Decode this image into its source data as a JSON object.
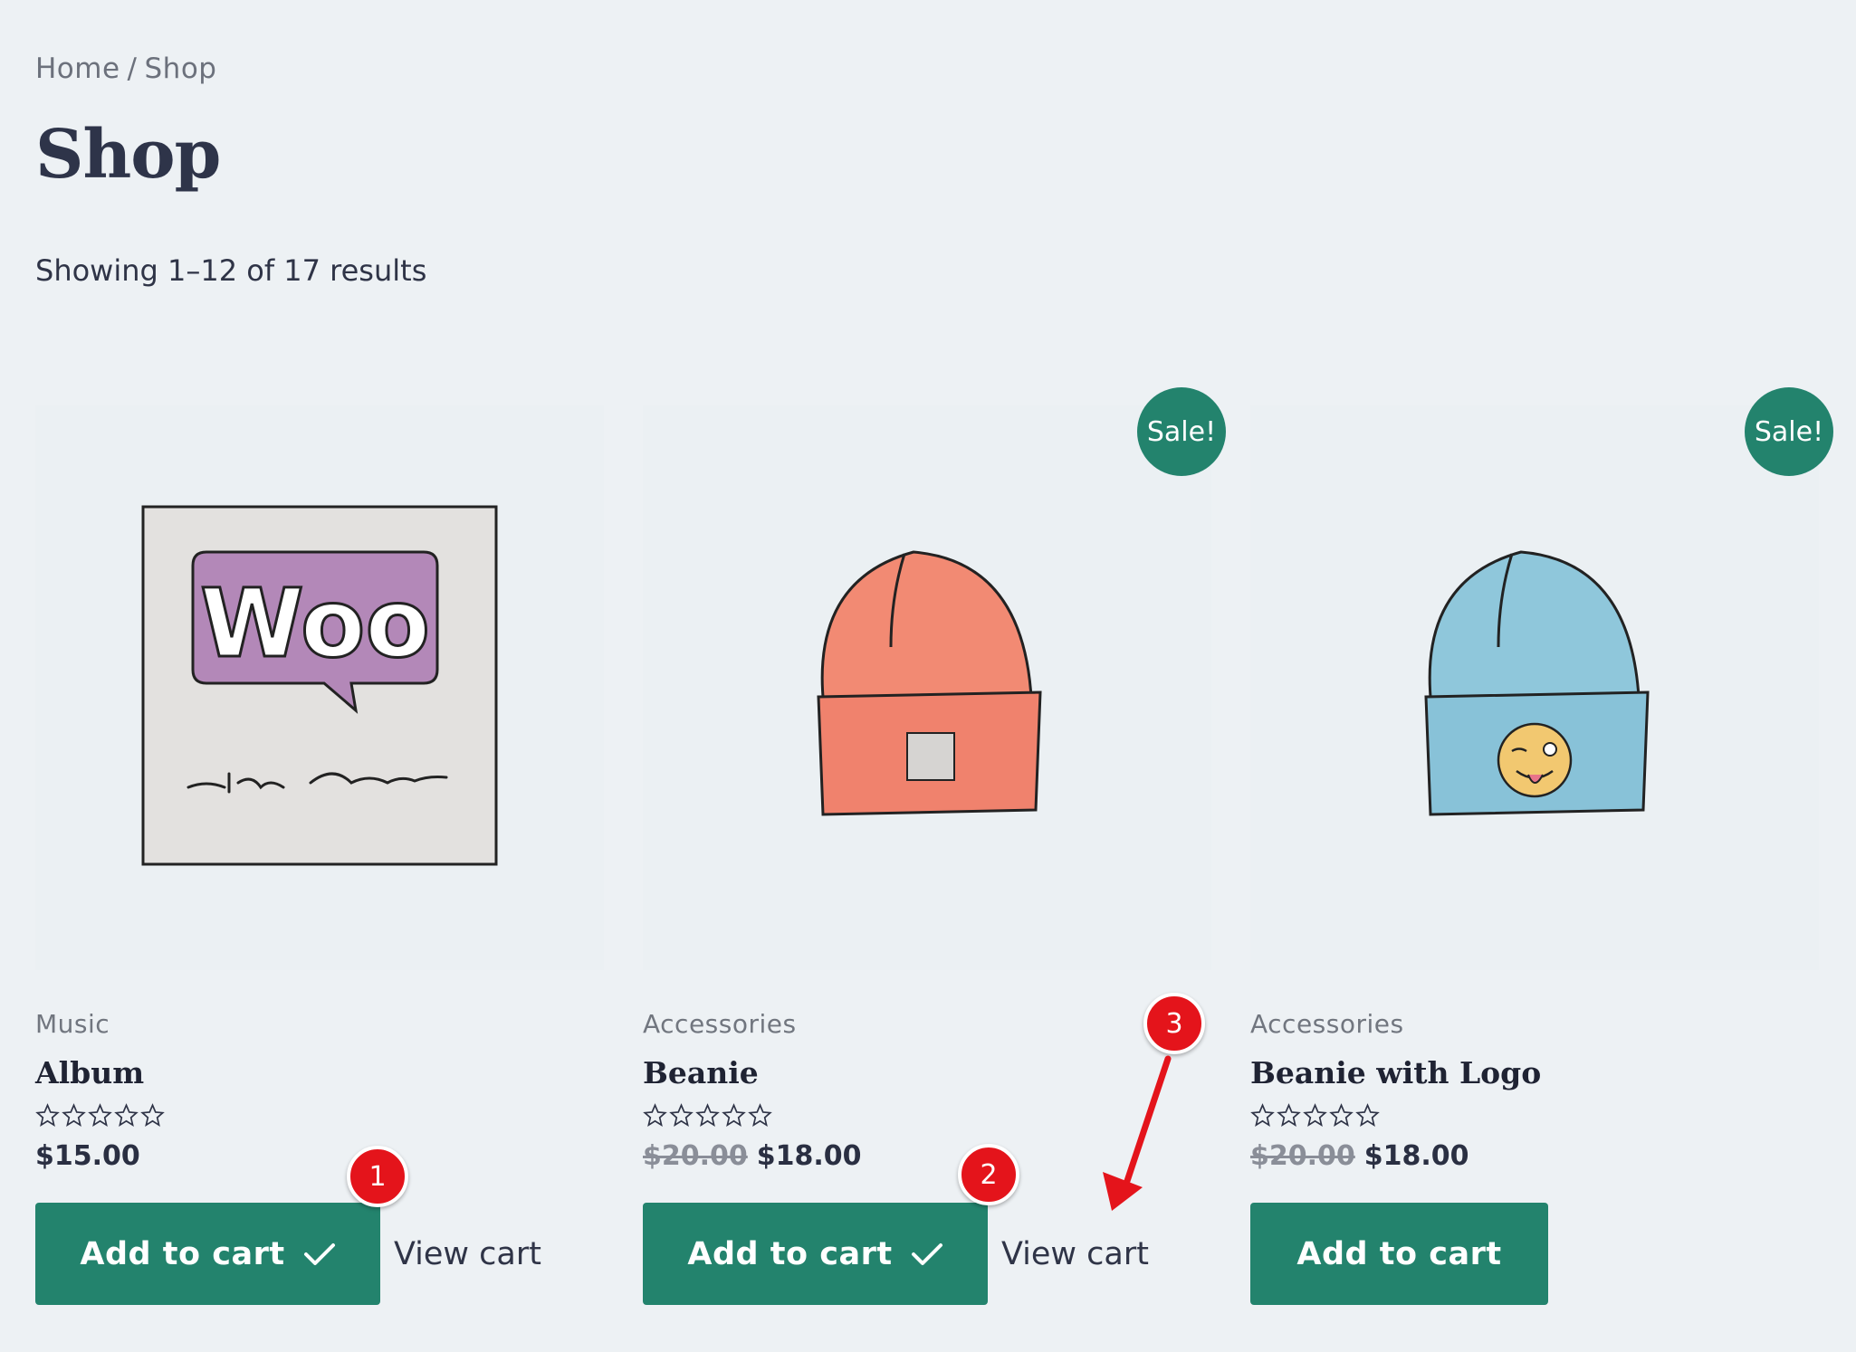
{
  "breadcrumb": {
    "home": "Home",
    "separator": "/",
    "current": "Shop"
  },
  "page": {
    "title": "Shop",
    "result_count": "Showing 1–12 of 17 results"
  },
  "products": [
    {
      "category": "Music",
      "name": "Album",
      "regular_price": "",
      "price": "$15.00",
      "on_sale": false,
      "sale_label": "",
      "rating": 0,
      "add_label": "Add to cart",
      "added": true,
      "view_cart": "View cart",
      "image_icon": "woo-album-icon"
    },
    {
      "category": "Accessories",
      "name": "Beanie",
      "regular_price": "$20.00",
      "price": "$18.00",
      "on_sale": true,
      "sale_label": "Sale!",
      "rating": 0,
      "add_label": "Add to cart",
      "added": true,
      "view_cart": "View cart",
      "image_icon": "beanie-icon"
    },
    {
      "category": "Accessories",
      "name": "Beanie with Logo",
      "regular_price": "$20.00",
      "price": "$18.00",
      "on_sale": true,
      "sale_label": "Sale!",
      "rating": 0,
      "add_label": "Add to cart",
      "added": false,
      "view_cart": "",
      "image_icon": "beanie-logo-icon"
    }
  ],
  "annotations": {
    "marker_1": "1",
    "marker_2": "2",
    "marker_3": "3"
  },
  "colors": {
    "accent": "#23836d",
    "marker": "#e4141b",
    "background": "#edf1f4"
  }
}
